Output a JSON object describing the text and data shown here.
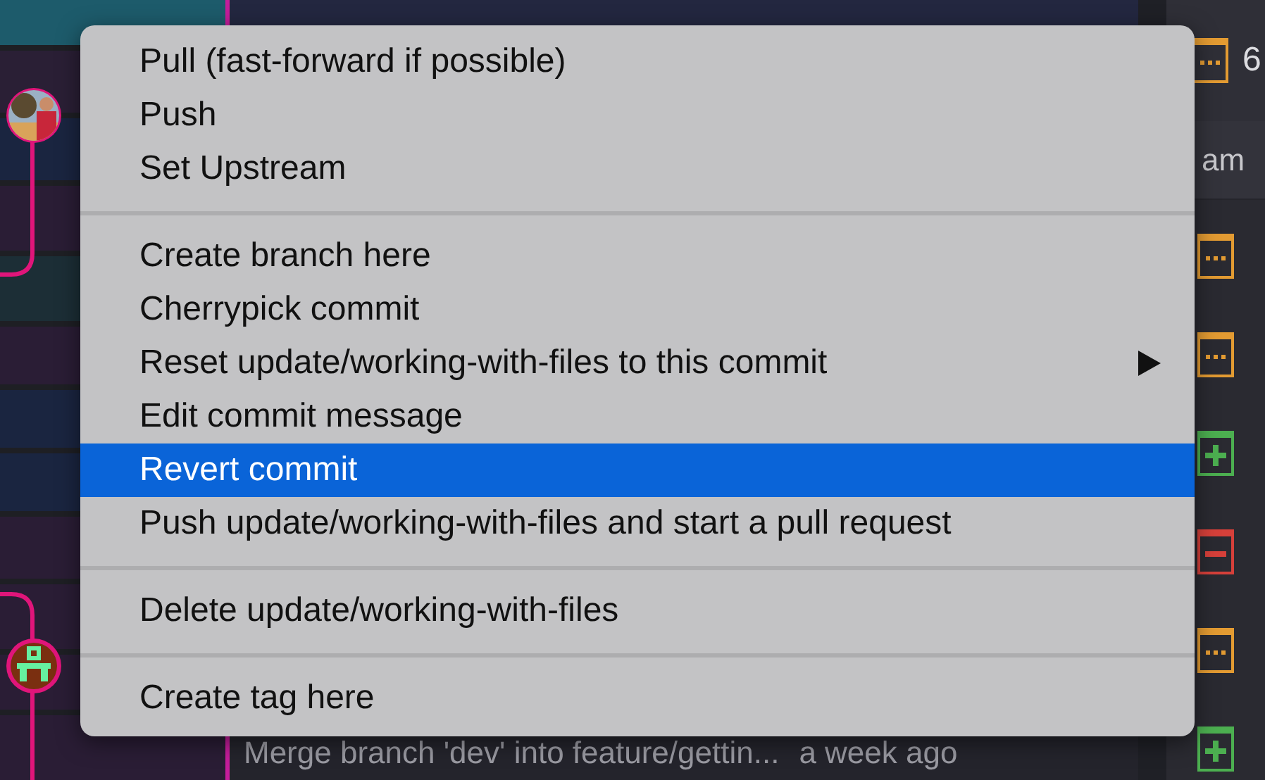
{
  "commit_list": {
    "visible_row": {
      "message": "Merge branch 'dev' into feature/gettin...",
      "time": "a week ago"
    }
  },
  "changed_files": {
    "summary": "6",
    "column_header": "am",
    "files": [
      {
        "kind": "modified"
      },
      {
        "kind": "modified"
      },
      {
        "kind": "added"
      },
      {
        "kind": "deleted"
      },
      {
        "kind": "modified"
      },
      {
        "kind": "added"
      }
    ]
  },
  "context_menu": {
    "groups": [
      [
        {
          "label": "Pull (fast-forward if possible)",
          "selected": false,
          "submenu": false
        },
        {
          "label": "Push",
          "selected": false,
          "submenu": false
        },
        {
          "label": "Set Upstream",
          "selected": false,
          "submenu": false
        }
      ],
      [
        {
          "label": "Create branch here",
          "selected": false,
          "submenu": false
        },
        {
          "label": "Cherrypick commit",
          "selected": false,
          "submenu": false
        },
        {
          "label": "Reset update/working-with-files to this commit",
          "selected": false,
          "submenu": true
        },
        {
          "label": "Edit commit message",
          "selected": false,
          "submenu": false
        },
        {
          "label": "Revert commit",
          "selected": true,
          "submenu": false
        },
        {
          "label": "Push update/working-with-files and start a pull request",
          "selected": false,
          "submenu": false
        }
      ],
      [
        {
          "label": "Delete update/working-with-files",
          "selected": false,
          "submenu": false
        }
      ],
      [
        {
          "label": "Create tag here",
          "selected": false,
          "submenu": false
        }
      ]
    ]
  }
}
